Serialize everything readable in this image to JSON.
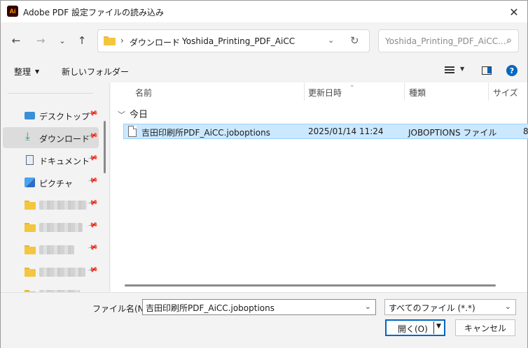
{
  "window": {
    "title": "Adobe PDF 設定ファイルの読み込み",
    "app_icon": "Ai"
  },
  "nav": {
    "breadcrumb": [
      "ダウンロード",
      "Yoshida_Printing_PDF_AiCC"
    ],
    "search_placeholder": "Yoshida_Printing_PDF_AiCC..."
  },
  "commands": {
    "organize": "整理",
    "new_folder": "新しいフォルダー"
  },
  "sidebar": {
    "items": [
      {
        "label": "デスクトップ",
        "icon": "desktop-icon",
        "pinned": true
      },
      {
        "label": "ダウンロード",
        "icon": "download-icon",
        "pinned": true,
        "selected": true
      },
      {
        "label": "ドキュメント",
        "icon": "document-icon",
        "pinned": true
      },
      {
        "label": "ピクチャ",
        "icon": "pictures-icon",
        "pinned": true
      }
    ]
  },
  "columns": {
    "name": "名前",
    "date": "更新日時",
    "type": "種類",
    "size": "サイズ"
  },
  "group": {
    "label": "今日"
  },
  "files": [
    {
      "name": "吉田印刷所PDF_AiCC.joboptions",
      "date": "2025/01/14 11:24",
      "type": "JOBOPTIONS ファイル",
      "size": "8"
    }
  ],
  "footer": {
    "filename_label": "ファイル名(N):",
    "filename_value": "吉田印刷所PDF_AiCC.joboptions",
    "filetype_value": "すべてのファイル (*.*)",
    "open_label": "開く(O)",
    "cancel_label": "キャンセル"
  },
  "colors": {
    "accent": "#0067c0",
    "selection": "#cce8ff",
    "folder": "#f3c63f"
  }
}
